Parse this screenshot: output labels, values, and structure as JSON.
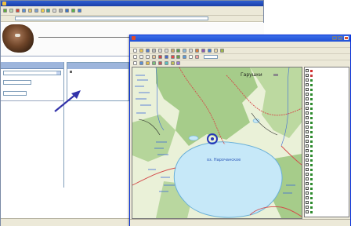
{
  "browser": {
    "title": "",
    "status_text": "",
    "address": "",
    "tree_items": [
      "",
      "",
      "",
      ""
    ],
    "caption": ""
  },
  "gis": {
    "title": "",
    "menu": [
      "",
      "",
      "",
      "",
      "",
      "",
      "",
      "",
      ""
    ],
    "zoom": "",
    "coords": "",
    "labels": {
      "town": "Гарушки",
      "lake": "оз. Нарочанское"
    },
    "layers": [
      {
        "name": "",
        "color": "#d22b2b",
        "checked": true
      },
      {
        "name": "",
        "color": "#c63c3c",
        "checked": true
      },
      {
        "name": "",
        "color": "#2e8b2e",
        "checked": true
      },
      {
        "name": "",
        "color": "#2e8b2e",
        "checked": true
      },
      {
        "name": "",
        "color": "#2e8b2e",
        "checked": true
      },
      {
        "name": "",
        "color": "#2e8b2e",
        "checked": true
      },
      {
        "name": "",
        "color": "#2e8b2e",
        "checked": true
      },
      {
        "name": "",
        "color": "#2e8b2e",
        "checked": true
      },
      {
        "name": "",
        "color": "#2e8b2e",
        "checked": true
      },
      {
        "name": "",
        "color": "#2e8b2e",
        "checked": true
      },
      {
        "name": "",
        "color": "#2e8b2e",
        "checked": true
      },
      {
        "name": "",
        "color": "#2e8b2e",
        "checked": true
      },
      {
        "name": "",
        "color": "#2e8b2e",
        "checked": true
      },
      {
        "name": "",
        "color": "#2e8b2e",
        "checked": true
      },
      {
        "name": "",
        "color": "#2e8b2e",
        "checked": true
      },
      {
        "name": "",
        "color": "#2e8b2e",
        "checked": true
      },
      {
        "name": "",
        "color": "#2e8b2e",
        "checked": true
      },
      {
        "name": "",
        "color": "#2e8b2e",
        "checked": true
      },
      {
        "name": "",
        "color": "#2e8b2e",
        "checked": true
      },
      {
        "name": "",
        "color": "#2e8b2e",
        "checked": true
      },
      {
        "name": "",
        "color": "#2e8b2e",
        "checked": true
      },
      {
        "name": "",
        "color": "#2e8b2e",
        "checked": true
      },
      {
        "name": "",
        "color": "#2e8b2e",
        "checked": true
      },
      {
        "name": "",
        "color": "#2e8b2e",
        "checked": true
      },
      {
        "name": "",
        "color": "#2e8b2e",
        "checked": true
      },
      {
        "name": "",
        "color": "#2e8b2e",
        "checked": true
      },
      {
        "name": "",
        "color": "#2e8b2e",
        "checked": true
      },
      {
        "name": "",
        "color": "#2e8b2e",
        "checked": true
      },
      {
        "name": "",
        "color": "#2e8b2e",
        "checked": true
      },
      {
        "name": "",
        "color": "#2e8b2e",
        "checked": true
      },
      {
        "name": "",
        "color": "#2e8b2e",
        "checked": true
      }
    ]
  },
  "colors": {
    "titlebar_browser": "#0a246a",
    "titlebar_gis": "#1f4fd6",
    "water": "#c6e8f8",
    "forest": "#a6cc8a",
    "meadow": "#eaf1d8",
    "road": "#d44a4a",
    "annotation": "#3333aa"
  }
}
